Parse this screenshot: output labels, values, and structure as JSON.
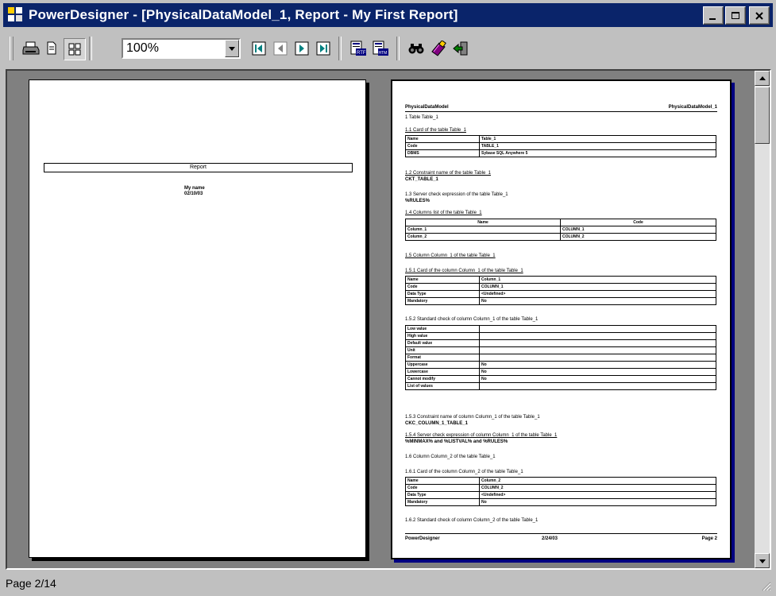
{
  "window": {
    "title": "PowerDesigner - [PhysicalDataModel_1, Report - My First Report]",
    "title_bar_color": "#0a246a",
    "buttons": {
      "minimize": "minimize-icon",
      "maximize": "maximize-icon",
      "close": "close-icon"
    }
  },
  "toolbar": {
    "zoom_value": "100%",
    "icons": [
      "print-icon",
      "single-page-icon",
      "two-page-icon",
      "first-page-icon",
      "previous-page-icon",
      "next-page-icon",
      "last-page-icon",
      "export-rtf-icon",
      "export-html-icon",
      "find-icon",
      "report-editor-icon",
      "exit-preview-icon"
    ]
  },
  "pages": {
    "left": {
      "title": "Report",
      "author": "My name",
      "date": "02/10/03"
    },
    "right": {
      "header_left": "PhysicalDataModel",
      "header_right": "PhysicalDataModel_1",
      "footer_left": "PowerDesigner",
      "footer_center": "2/24/03",
      "footer_right": "Page 2",
      "sections": {
        "s1": "1 Table Table_1",
        "s11": "1.1 Card of the table Table_1",
        "s12": "1.2 Constraint name of the table Table_1",
        "s12_val": "CKT_TABLE_1",
        "s13": "1.3 Server check expression of the table Table_1",
        "s13_val": "%RULES%",
        "s14": "1.4 Columns list of the table Table_1",
        "s15": "1.5 Column Column_1 of the table Table_1",
        "s151": "1.5.1 Card of the column Column_1 of the table Table_1",
        "s152": "1.5.2 Standard check of column Column_1 of the table Table_1",
        "s153": "1.5.3 Constraint name of column Column_1 of the table Table_1",
        "s153_val": "CKC_COLUMN_1_TABLE_1",
        "s154": "1.5.4 Server check expression of column Column_1 of the table Table_1",
        "s154_val": "%MINMAX% and %LISTVAL% and %RULES%",
        "s16": "1.6 Column Column_2 of the table Table_1",
        "s161": "1.6.1 Card of the column Column_2 of the table Table_1",
        "s162": "1.6.2 Standard check of column Column_2 of the table Table_1"
      },
      "card_table": [
        [
          "Name",
          "Table_1"
        ],
        [
          "Code",
          "TABLE_1"
        ],
        [
          "DBMS",
          "Sybase SQL Anywhere 5"
        ]
      ],
      "columns_table": {
        "headers": [
          "Name",
          "Code"
        ],
        "rows": [
          [
            "Column_1",
            "COLUMN_1"
          ],
          [
            "Column_2",
            "COLUMN_2"
          ]
        ]
      },
      "col1_card": [
        [
          "Name",
          "Column_1"
        ],
        [
          "Code",
          "COLUMN_1"
        ],
        [
          "Data Type",
          "<Undefined>"
        ],
        [
          "Mandatory",
          "No"
        ]
      ],
      "col1_check": [
        [
          "Low value",
          ""
        ],
        [
          "High value",
          ""
        ],
        [
          "Default value",
          ""
        ],
        [
          "Unit",
          ""
        ],
        [
          "Format",
          ""
        ],
        [
          "Uppercase",
          "No"
        ],
        [
          "Lowercase",
          "No"
        ],
        [
          "Cannot modify",
          "No"
        ],
        [
          "List of values",
          ""
        ]
      ],
      "col2_card": [
        [
          "Name",
          "Column_2"
        ],
        [
          "Code",
          "COLUMN_2"
        ],
        [
          "Data Type",
          "<Undefined>"
        ],
        [
          "Mandatory",
          "No"
        ]
      ]
    }
  },
  "status": {
    "text": "Page 2/14"
  }
}
